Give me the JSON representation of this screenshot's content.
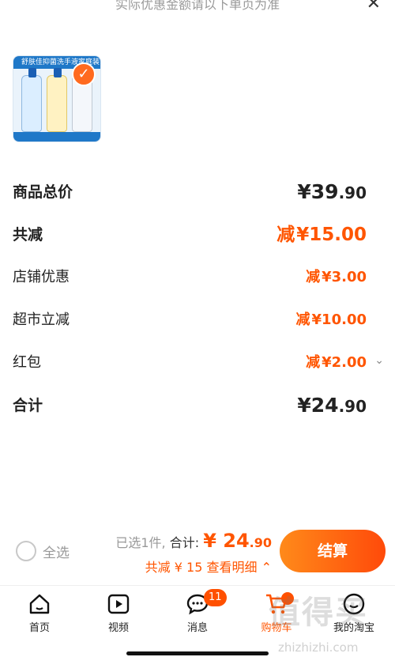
{
  "header": {
    "note": "实际优惠金额请以下单页为准",
    "close_icon": "close-icon"
  },
  "product": {
    "banner_text": "舒肤佳抑菌洗手液家庭装",
    "selected": true,
    "icon": "checkmark-icon",
    "brand_color": "#1f78c8"
  },
  "summary": {
    "rows": [
      {
        "label": "商品总价",
        "prefix": "",
        "amount": "¥39",
        "cents": ".90"
      },
      {
        "label": "共减",
        "prefix": "减",
        "amount": "¥15.00",
        "cents": ""
      },
      {
        "label": "店铺优惠",
        "prefix": "减",
        "amount": "¥3.00",
        "cents": ""
      },
      {
        "label": "超市立减",
        "prefix": "减",
        "amount": "¥10.00",
        "cents": ""
      },
      {
        "label": "红包",
        "prefix": "减",
        "amount": "¥2.00",
        "cents": ""
      },
      {
        "label": "合计",
        "prefix": "",
        "amount": "¥24",
        "cents": ".90"
      }
    ]
  },
  "checkout_bar": {
    "select_all": "全选",
    "selected_count": "已选1件,",
    "total_label": "合计:",
    "total_amount": "¥ 24",
    "total_cents": ".90",
    "discount_text": "共减 ¥ 15",
    "details_link": "查看明细",
    "checkout_button": "结算",
    "accent": "#ff5500"
  },
  "tabbar": {
    "tabs": [
      {
        "label": "首页",
        "icon": "home-icon"
      },
      {
        "label": "视频",
        "icon": "video-icon"
      },
      {
        "label": "消息",
        "icon": "message-icon",
        "badge": "11"
      },
      {
        "label": "购物车",
        "icon": "cart-icon"
      },
      {
        "label": "我的淘宝",
        "icon": "profile-icon"
      }
    ]
  },
  "watermark": {
    "text": "值得买",
    "url_text": "zhizhizhi.com"
  }
}
